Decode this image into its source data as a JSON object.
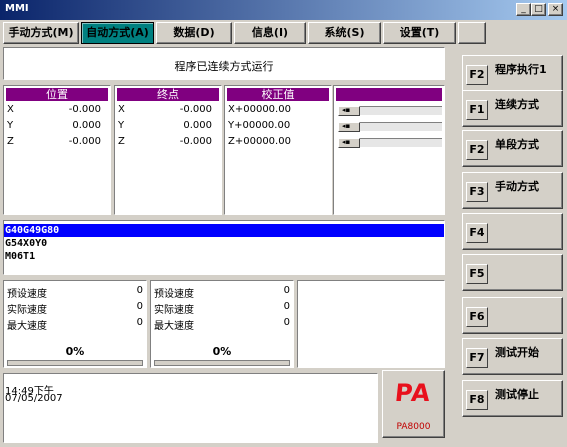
{
  "window": {
    "title": "MMI",
    "min_label": "_",
    "max_label": "□",
    "close_label": "×"
  },
  "tabs": [
    {
      "label": "手动方式(M)",
      "active": false
    },
    {
      "label": "自动方式(A)",
      "active": true
    },
    {
      "label": "数据(D)",
      "active": false
    },
    {
      "label": "信息(I)",
      "active": false
    },
    {
      "label": "系统(S)",
      "active": false
    },
    {
      "label": "设置(T)",
      "active": false
    },
    {
      "label": "",
      "active": false
    }
  ],
  "status": "程序已连续方式运行",
  "panels": {
    "position": {
      "header": "位置",
      "rows": [
        {
          "axis": "X",
          "value": "-0.000"
        },
        {
          "axis": "Y",
          "value": "0.000"
        },
        {
          "axis": "Z",
          "value": "-0.000"
        }
      ]
    },
    "endpoint": {
      "header": "终点",
      "rows": [
        {
          "axis": "X",
          "value": "-0.000"
        },
        {
          "axis": "Y",
          "value": "0.000"
        },
        {
          "axis": "Z",
          "value": "-0.000"
        }
      ]
    },
    "correction": {
      "header": "校正值",
      "rows": [
        {
          "text": "X+00000.00"
        },
        {
          "text": "Y+00000.00"
        },
        {
          "text": "Z+00000.00"
        }
      ]
    }
  },
  "program_lines": [
    "G40G49G80",
    "G54X0Y0",
    "M06T1"
  ],
  "speed_left": {
    "rows": [
      {
        "label": "预设速度",
        "value": "0"
      },
      {
        "label": "实际速度",
        "value": "0"
      },
      {
        "label": "最大速度",
        "value": "0"
      }
    ],
    "percent": "0%"
  },
  "speed_right": {
    "rows": [
      {
        "label": "预设速度",
        "value": "0"
      },
      {
        "label": "实际速度",
        "value": "0"
      },
      {
        "label": "最大速度",
        "value": "0"
      }
    ],
    "percent": "0%"
  },
  "clock": {
    "time": "14:49下午",
    "date": "07/05/2007"
  },
  "logo": {
    "mark": "PA",
    "model": "PA8000"
  },
  "fkeys": [
    {
      "key": "F2",
      "label": "程序执行1"
    },
    {
      "key": "F1",
      "label": "连续方式"
    },
    {
      "key": "F2",
      "label": "单段方式"
    },
    {
      "key": "F3",
      "label": "手动方式"
    },
    {
      "key": "F4",
      "label": ""
    },
    {
      "key": "F5",
      "label": ""
    },
    {
      "key": "F6",
      "label": ""
    },
    {
      "key": "F7",
      "label": "测试开始"
    },
    {
      "key": "F8",
      "label": "测试停止"
    }
  ],
  "colors": {
    "title_bar": "#0a246a",
    "panel_header": "#800080",
    "active_tab": "#008080",
    "selected_line": "#0000ff",
    "logo": "#e8101c"
  }
}
